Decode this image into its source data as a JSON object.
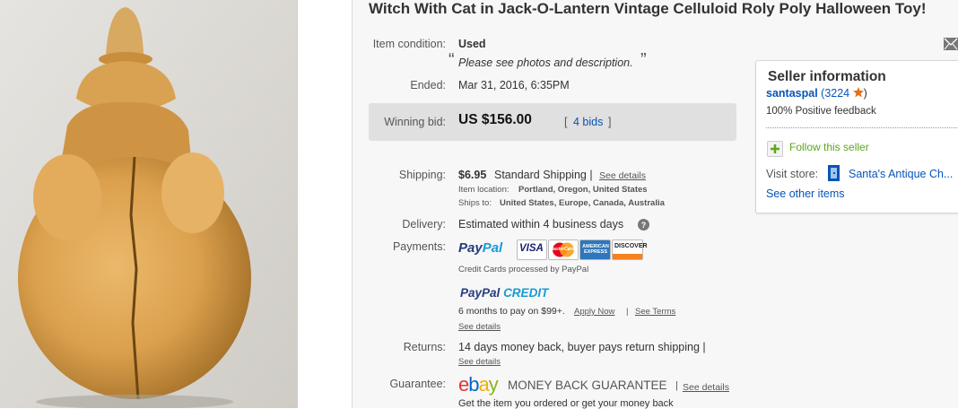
{
  "listing": {
    "title": "Witch With Cat in Jack-O-Lantern Vintage Celluloid Roly Poly Halloween Toy!"
  },
  "condition": {
    "label": "Item condition:",
    "value": "Used",
    "quote_open": "“",
    "note": "Please see photos and description.",
    "quote_close": "”"
  },
  "ended": {
    "label": "Ended:",
    "value": "Mar 31, 2016, 6:35PM"
  },
  "bid": {
    "label": "Winning bid:",
    "price": "US $156.00",
    "bids_open": "[",
    "bids_link": "4 bids",
    "bids_close": "]"
  },
  "shipping": {
    "label": "Shipping:",
    "price": "$6.95",
    "method": "Standard Shipping |",
    "details_link": "See details",
    "location_label": "Item location:",
    "location": "Portland, Oregon, United States",
    "ships_label": "Ships to:",
    "ships_to": "United States, Europe, Canada, Australia"
  },
  "delivery": {
    "label": "Delivery:",
    "value": "Estimated within 4 business days",
    "help_icon": "question-circle-icon"
  },
  "payments": {
    "label": "Payments:",
    "paypal_logo_a": "Pay",
    "paypal_logo_b": "Pal",
    "cards": [
      "VISA",
      "MasterCard",
      "AMERICAN EXPRESS",
      "DISCOVER"
    ],
    "card_note": "Credit Cards processed by PayPal",
    "credit_logo_a": "PayPal",
    "credit_logo_b": "CREDIT",
    "credit_terms": "6 months to pay on $99+.",
    "apply_link": "Apply Now",
    "sep": "|",
    "terms_link": "See Terms",
    "details_link": "See details"
  },
  "returns": {
    "label": "Returns:",
    "value": "14 days money back, buyer pays return shipping |",
    "details_link": "See details"
  },
  "guarantee": {
    "label": "Guarantee:",
    "ebay_e": "e",
    "ebay_b": "b",
    "ebay_a": "a",
    "ebay_y": "y",
    "mbg": "MONEY BACK GUARANTEE",
    "sep": "|",
    "details_link": "See details",
    "sub": "Get the item you ordered or get your money back"
  },
  "seller": {
    "heading": "Seller information",
    "name": "santaspal",
    "score": "(3224",
    "score_close": ")",
    "feedback": "100% Positive feedback",
    "follow": "Follow this seller",
    "visit_label": "Visit store:",
    "store_name": "Santa's Antique Ch...",
    "other_items": "See other items"
  },
  "colors": {
    "link_blue": "#0654ba",
    "ebay_red": "#e53238",
    "ebay_blue": "#0064d2",
    "ebay_yellow": "#f5af02",
    "ebay_green": "#86b817",
    "star_orange": "#e2701a"
  }
}
